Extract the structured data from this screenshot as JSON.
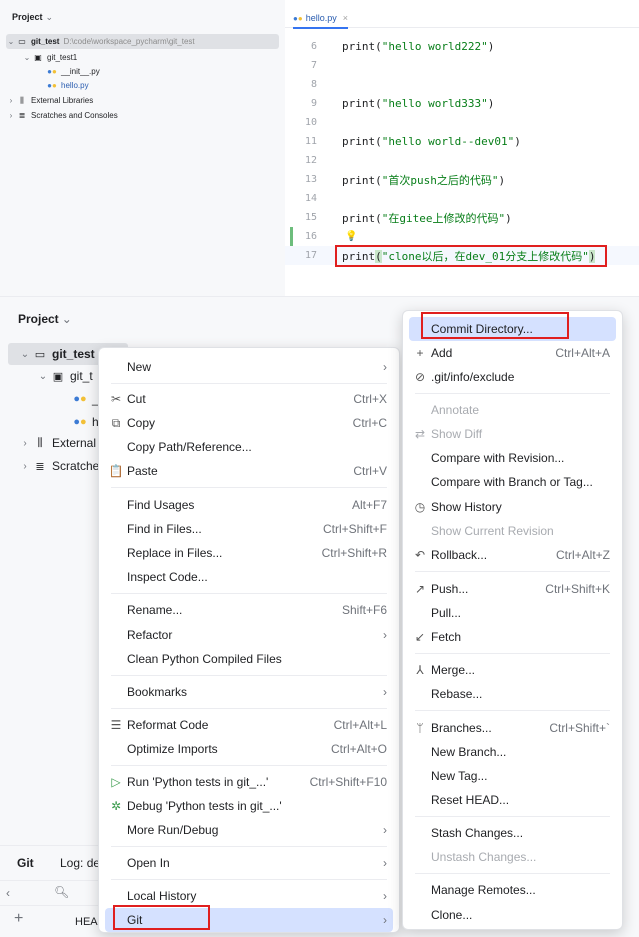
{
  "top": {
    "project_title": "Project",
    "tree": [
      {
        "label": "git_test",
        "path": "D:\\code\\workspace_pycharm\\git_test"
      },
      {
        "label": "git_test1"
      },
      {
        "label": "__init__.py"
      },
      {
        "label": "hello.py"
      },
      {
        "label": "External Libraries"
      },
      {
        "label": "Scratches and Consoles"
      }
    ],
    "tab_label": "hello.py",
    "lines": [
      {
        "n": "6",
        "fn": "print(",
        "str": "\"hello world222\"",
        "end": ")"
      },
      {
        "n": "7"
      },
      {
        "n": "8"
      },
      {
        "n": "9",
        "fn": "print(",
        "str": "\"hello world333\"",
        "end": ")"
      },
      {
        "n": "10"
      },
      {
        "n": "11",
        "fn": "print(",
        "str": "\"hello world--dev01\"",
        "end": ")"
      },
      {
        "n": "12"
      },
      {
        "n": "13",
        "fn": "print(",
        "str": "\"首次push之后的代码\"",
        "end": ")"
      },
      {
        "n": "14"
      },
      {
        "n": "15",
        "fn": "print(",
        "str": "\"在gitee上修改的代码\"",
        "end": ")"
      },
      {
        "n": "16"
      },
      {
        "n": "17",
        "fn": "print",
        "p1": "(",
        "str": "\"clone以后，在dev_01分支上修改代码\"",
        "p2": ")"
      }
    ]
  },
  "bottom": {
    "project_title": "Project",
    "tree": [
      {
        "label": "git_test"
      },
      {
        "label": "git_t"
      },
      {
        "label": "_"
      },
      {
        "label": "h"
      },
      {
        "label": "External"
      },
      {
        "label": "Scratche"
      }
    ],
    "git_tool": {
      "title": "Git",
      "log_tab": "Log: de",
      "head_label": "HEA"
    }
  },
  "context_menu": [
    {
      "label": "New",
      "sub": true
    },
    {
      "label": "Cut",
      "icon": "✂",
      "shortcut": "Ctrl+X"
    },
    {
      "label": "Copy",
      "icon": "⧉",
      "shortcut": "Ctrl+C"
    },
    {
      "label": "Copy Path/Reference..."
    },
    {
      "label": "Paste",
      "icon": "📋",
      "shortcut": "Ctrl+V"
    },
    {
      "label": "Find Usages",
      "shortcut": "Alt+F7"
    },
    {
      "label": "Find in Files...",
      "shortcut": "Ctrl+Shift+F"
    },
    {
      "label": "Replace in Files...",
      "shortcut": "Ctrl+Shift+R"
    },
    {
      "label": "Inspect Code..."
    },
    {
      "label": "Rename...",
      "shortcut": "Shift+F6"
    },
    {
      "label": "Refactor",
      "sub": true
    },
    {
      "label": "Clean Python Compiled Files"
    },
    {
      "label": "Bookmarks",
      "sub": true
    },
    {
      "label": "Reformat Code",
      "icon": "☰",
      "shortcut": "Ctrl+Alt+L"
    },
    {
      "label": "Optimize Imports",
      "shortcut": "Ctrl+Alt+O"
    },
    {
      "label": "Run 'Python tests in git_...'",
      "icon": "▷",
      "shortcut": "Ctrl+Shift+F10"
    },
    {
      "label": "Debug 'Python tests in git_...'",
      "icon": "✲"
    },
    {
      "label": "More Run/Debug",
      "sub": true
    },
    {
      "label": "Open In",
      "sub": true
    },
    {
      "label": "Local History",
      "sub": true
    },
    {
      "label": "Git",
      "sub": true
    }
  ],
  "git_menu": [
    {
      "label": "Commit Directory..."
    },
    {
      "label": "Add",
      "icon": "+",
      "shortcut": "Ctrl+Alt+A"
    },
    {
      "label": ".git/info/exclude",
      "icon": "⊘"
    },
    {
      "label": "Annotate",
      "disabled": true
    },
    {
      "label": "Show Diff",
      "icon": "⇄",
      "disabled": true
    },
    {
      "label": "Compare with Revision..."
    },
    {
      "label": "Compare with Branch or Tag..."
    },
    {
      "label": "Show History",
      "icon": "◷"
    },
    {
      "label": "Show Current Revision",
      "disabled": true
    },
    {
      "label": "Rollback...",
      "icon": "↶",
      "shortcut": "Ctrl+Alt+Z"
    },
    {
      "label": "Push...",
      "icon": "↗",
      "shortcut": "Ctrl+Shift+K"
    },
    {
      "label": "Pull..."
    },
    {
      "label": "Fetch",
      "icon": "↙"
    },
    {
      "label": "Merge...",
      "icon": "⅄"
    },
    {
      "label": "Rebase..."
    },
    {
      "label": "Branches...",
      "icon": "ᛘ",
      "shortcut": "Ctrl+Shift+`"
    },
    {
      "label": "New Branch..."
    },
    {
      "label": "New Tag..."
    },
    {
      "label": "Reset HEAD..."
    },
    {
      "label": "Stash Changes..."
    },
    {
      "label": "Unstash Changes...",
      "disabled": true
    },
    {
      "label": "Manage Remotes..."
    },
    {
      "label": "Clone..."
    }
  ],
  "colors": {
    "highlight_box": "#e01f1f",
    "accent": "#3574f0",
    "string": "#067d17"
  }
}
